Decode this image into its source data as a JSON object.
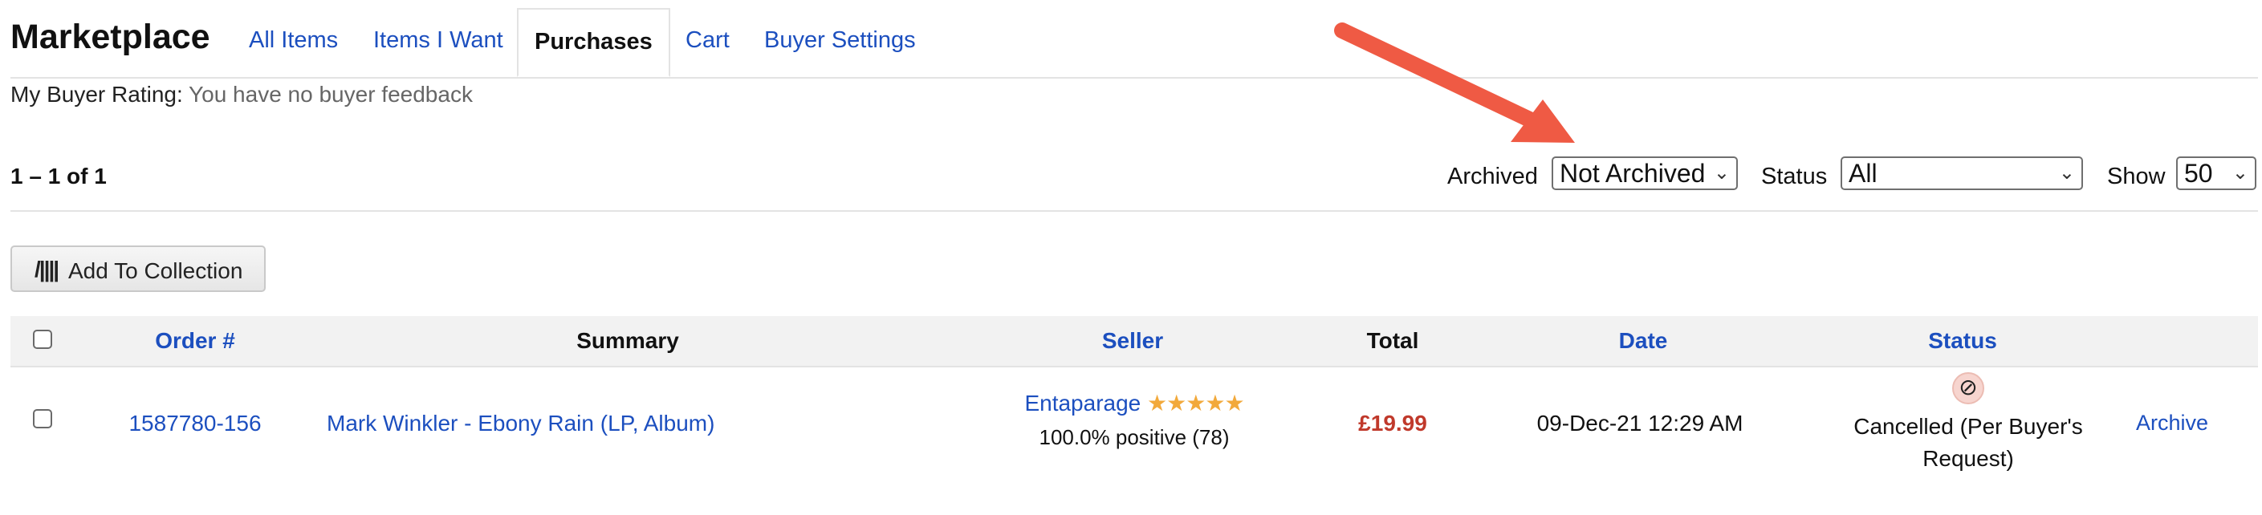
{
  "header": {
    "title": "Marketplace",
    "tabs": [
      {
        "label": "All Items",
        "active": false
      },
      {
        "label": "Items I Want",
        "active": false
      },
      {
        "label": "Purchases",
        "active": true
      },
      {
        "label": "Cart",
        "active": false
      },
      {
        "label": "Buyer Settings",
        "active": false
      }
    ]
  },
  "rating": {
    "label": "My Buyer Rating:",
    "value": "You have no buyer feedback"
  },
  "controls": {
    "count": "1 – 1 of 1",
    "archived_label": "Archived",
    "archived_value": "Not Archived",
    "status_label": "Status",
    "status_value": "All",
    "show_label": "Show",
    "show_value": "50"
  },
  "toolbar": {
    "add_to_collection": "Add To Collection",
    "add_icon": "collection-icon"
  },
  "table": {
    "columns": [
      "Order #",
      "Summary",
      "Seller",
      "Total",
      "Date",
      "Status"
    ],
    "rows": [
      {
        "order": "1587780-156",
        "summary": "Mark Winkler - Ebony Rain (LP, Album)",
        "seller_name": "Entaparage",
        "seller_stars": "★★★★★",
        "seller_rating": "100.0% positive (78)",
        "total": "£19.99",
        "date": "09-Dec-21 12:29 AM",
        "status_icon": "⊘",
        "status": "Cancelled (Per Buyer's Request)",
        "action": "Archive"
      }
    ]
  },
  "colors": {
    "link": "#1c4fbf",
    "price": "#c0392b",
    "arrow": "#ef5a44",
    "stars": "#f2a93b"
  }
}
